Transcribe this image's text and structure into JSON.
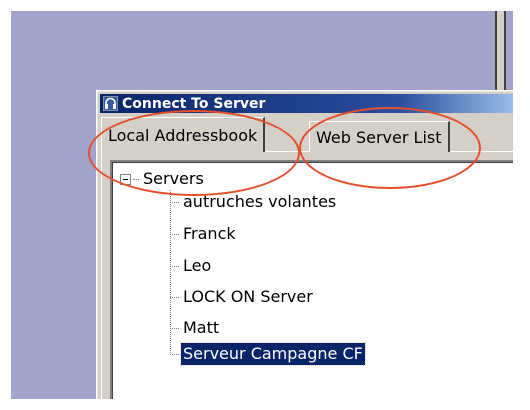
{
  "window": {
    "title": "Connect To Server"
  },
  "tabs": [
    {
      "label": "Local Addressbook",
      "active": true
    },
    {
      "label": "Web Server List",
      "active": false
    }
  ],
  "tree": {
    "root_label": "Servers",
    "items": [
      {
        "label": "autruches volantes",
        "selected": false
      },
      {
        "label": "Franck",
        "selected": false
      },
      {
        "label": "Leo",
        "selected": false
      },
      {
        "label": "LOCK ON Server",
        "selected": false
      },
      {
        "label": "Matt",
        "selected": false
      },
      {
        "label": "Serveur Campagne CF",
        "selected": true
      }
    ]
  },
  "annotation": {
    "highlight_color": "#e64e2c"
  },
  "icons": {
    "app_icon": "headphones-icon",
    "expander": "tree-collapse-icon"
  }
}
